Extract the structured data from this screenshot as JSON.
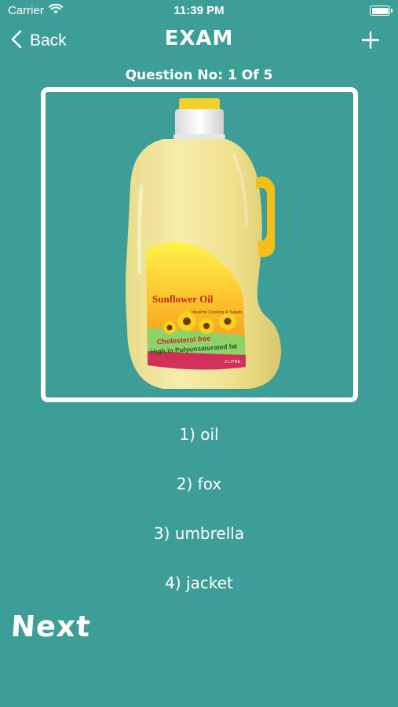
{
  "status_bar": {
    "carrier": "Carrier",
    "time": "11:39 PM",
    "battery_level": 1.0,
    "icons": [
      "wifi-icon",
      "battery-icon"
    ]
  },
  "nav": {
    "back_label": "Back",
    "title": "EXAM",
    "back_icon": "chevron-left-icon",
    "add_icon": "plus-icon"
  },
  "question": {
    "label": "Question No: 1 Of 5",
    "image": {
      "brand_text": "Sunflower Oil",
      "label_line_1": "Cholesterol free",
      "label_line_2": "High in Polyunsaturated fat",
      "volume": "2 LITRE",
      "small_text": "Ideal for Cooking & Salads"
    },
    "options": [
      "1) oil",
      "2) fox",
      "3) umbrella",
      "4) jacket"
    ]
  },
  "next_label": "Next",
  "colors": {
    "background": "#3c9e97",
    "text": "#ffffff",
    "frame": "#ffffff",
    "image_bg": "#3c9e97"
  }
}
